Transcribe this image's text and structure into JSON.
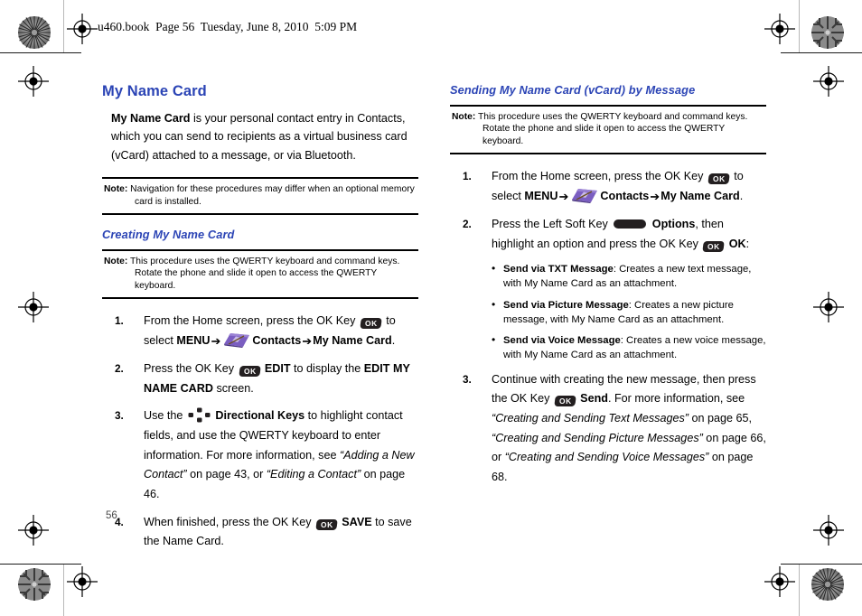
{
  "print_header": "u460.book  Page 56  Tuesday, June 8, 2010  5:09 PM",
  "page_number": "56",
  "colors": {
    "heading_blue": "#2b44b5",
    "key_dark": "#231f20",
    "contacts_purple": "#7b5ec1",
    "contacts_purple_dark": "#5f46a0"
  },
  "left_column": {
    "title": "My Name Card",
    "intro": {
      "bold_lead": "My Name Card",
      "rest": " is your personal contact entry in Contacts, which you can send to recipients as a virtual business card (vCard) attached to a message, or via Bluetooth."
    },
    "note": {
      "label": "Note:",
      "text": " Navigation for these procedures may differ when an optional memory card is installed."
    },
    "section_title": "Creating My Name Card",
    "section_note": {
      "label": "Note:",
      "text": " This procedure uses the QWERTY keyboard and command keys. Rotate the phone and slide it open to access the QWERTY keyboard."
    },
    "steps": [
      {
        "num": "1.",
        "part_a": "From the Home screen, press the OK Key ",
        "key": "OK",
        "part_b": " to select ",
        "bold_menu": "MENU",
        "arrow1": "➔",
        "icon": "contacts-icon",
        "bold_contacts": "Contacts",
        "arrow2": "➔",
        "bold_target": "My Name Card",
        "part_end": "."
      },
      {
        "num": "2.",
        "part_a": "Press the OK Key ",
        "key": "OK",
        "bold_b": " EDIT",
        "part_b": " to display the ",
        "bold_c": "EDIT MY NAME CARD",
        "part_c": " screen."
      },
      {
        "num": "3.",
        "part_a": "Use the ",
        "icon": "directional-keys-icon",
        "bold_b": " Directional Keys",
        "part_b": " to highlight contact fields, and use the QWERTY keyboard to enter information. For more information, see ",
        "italic_a": "“Adding a New Contact”",
        "part_c": " on page 43, or ",
        "italic_b": "“Editing a Contact”",
        "part_d": " on page 46."
      },
      {
        "num": "4.",
        "part_a": "When finished, press the OK Key ",
        "key": "OK",
        "bold_b": " SAVE",
        "part_b": " to save the Name Card."
      }
    ]
  },
  "right_column": {
    "section_title": "Sending My Name Card (vCard) by Message",
    "note": {
      "label": "Note:",
      "text": " This procedure uses the QWERTY keyboard and command keys. Rotate the phone and slide it open to access the QWERTY keyboard."
    },
    "steps": [
      {
        "num": "1.",
        "part_a": "From the Home screen, press the OK Key ",
        "key": "OK",
        "part_b": " to select ",
        "bold_menu": "MENU",
        "arrow1": "➔",
        "icon": "contacts-icon",
        "bold_contacts": "Contacts",
        "arrow2": "➔",
        "bold_target": "My Name Card",
        "part_end": "."
      },
      {
        "num": "2.",
        "part_a": "Press the Left Soft Key ",
        "softkey": "left-soft-key",
        "bold_b": " Options",
        "part_b": ", then highlight an option and press the OK Key ",
        "key": "OK",
        "bold_c": " OK",
        "part_c": ":",
        "bullets": [
          {
            "bold": "Send via TXT Message",
            "text": ": Creates a new text message, with My Name Card as an attachment."
          },
          {
            "bold": "Send via Picture Message",
            "text": ": Creates a new picture message, with My Name Card as an attachment."
          },
          {
            "bold": "Send via Voice Message",
            "text": ": Creates a new voice message, with My Name Card as an attachment."
          }
        ]
      },
      {
        "num": "3.",
        "part_a": "Continue with creating the new message, then press the OK Key ",
        "key": "OK",
        "bold_b": " Send",
        "part_b": ". For more information, see ",
        "italic_a": "“Creating and Sending Text Messages”",
        "part_c": " on page 65, ",
        "italic_b": "“Creating and Sending Picture Messages”",
        "part_d": " on page 66, or ",
        "italic_c": "“Creating and Sending Voice Messages”",
        "part_e": " on page 68."
      }
    ]
  }
}
